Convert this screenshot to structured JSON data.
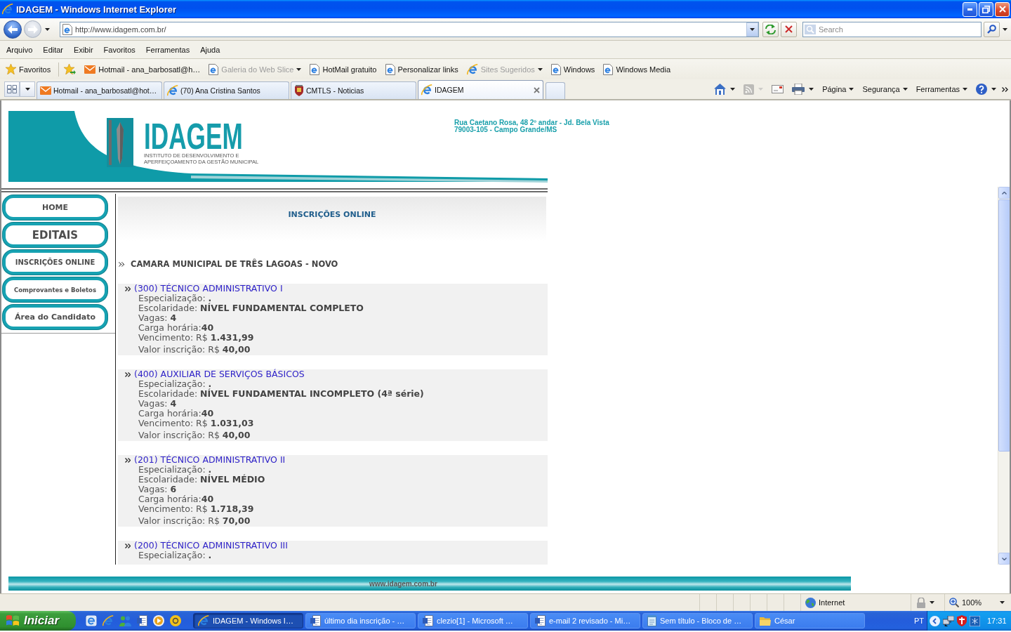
{
  "window": {
    "title": "IDAGEM - Windows Internet Explorer"
  },
  "address_bar": {
    "url": "http://www.idagem.com.br/"
  },
  "search": {
    "placeholder": "Search"
  },
  "menu": [
    "Arquivo",
    "Editar",
    "Exibir",
    "Favoritos",
    "Ferramentas",
    "Ajuda"
  ],
  "favorites_bar": {
    "label": "Favoritos",
    "links": [
      {
        "label": "Hotmail - ana_barbosatl@h…",
        "kind": "mail",
        "disabled": false,
        "dropdown": false
      },
      {
        "label": "Galeria do Web Slice",
        "kind": "page",
        "disabled": true,
        "dropdown": true
      },
      {
        "label": "HotMail gratuito",
        "kind": "page",
        "disabled": false,
        "dropdown": false
      },
      {
        "label": "Personalizar links",
        "kind": "page",
        "disabled": false,
        "dropdown": false
      },
      {
        "label": "Sites Sugeridos",
        "kind": "ie",
        "disabled": true,
        "dropdown": true
      },
      {
        "label": "Windows",
        "kind": "page",
        "disabled": false,
        "dropdown": false
      },
      {
        "label": "Windows Media",
        "kind": "page",
        "disabled": false,
        "dropdown": false
      }
    ]
  },
  "tabs": [
    {
      "label": "Hotmail - ana_barbosatl@hot…",
      "kind": "mail",
      "selected": false
    },
    {
      "label": "(70) Ana Cristina Santos",
      "kind": "ie",
      "selected": false
    },
    {
      "label": "CMTLS - Noticias",
      "kind": "crest",
      "selected": false
    },
    {
      "label": "IDAGEM",
      "kind": "ie",
      "selected": true
    }
  ],
  "command_bar": {
    "tools": [
      {
        "kind": "home",
        "dropdown": true,
        "disabled": false
      },
      {
        "kind": "feeds",
        "dropdown": true,
        "disabled": true
      },
      {
        "kind": "mail",
        "dropdown": false,
        "disabled": false
      },
      {
        "kind": "print",
        "dropdown": true,
        "disabled": false
      }
    ],
    "menus": [
      "Página",
      "Segurança",
      "Ferramentas"
    ]
  },
  "site": {
    "logo": {
      "wordmark": "IDAGEM",
      "tagline": [
        "INSTITUTO DE DESENVOLVIMENTO E",
        "APERFEIÇOAMENTO DA GESTÃO MUNICIPAL"
      ]
    },
    "address": [
      "Rua Caetano Rosa, 48 2º andar - Jd. Bela Vista",
      "79003-105 - Campo Grande/MS"
    ],
    "nav": [
      "HOME",
      "EDITAIS",
      "INSCRIÇÕES ONLINE",
      "Comprovantes e Boletos",
      "Área do Candidato"
    ],
    "heading": "INSCRIÇÕES ONLINE",
    "organization": "CAMARA MUNICIPAL DE TRÊS LAGOAS - NOVO",
    "positions": [
      {
        "title": "(300) TÉCNICO ADMINISTRATIVO I",
        "details": [
          "Especialização: **.**",
          "Escolaridade: **NÍVEL FUNDAMENTAL COMPLETO**",
          "Vagas: **4**",
          "Carga horária:**40**",
          "Vencimento: R$ **1.431,99**",
          "Valor inscrição: R$ **40,00**"
        ]
      },
      {
        "title": "(400) AUXILIAR DE SERVIÇOS BÁSICOS",
        "details": [
          "Especialização: **.**",
          "Escolaridade: **NÍVEL FUNDAMENTAL INCOMPLETO (4ª série)**",
          "Vagas: **4**",
          "Carga horária:**40**",
          "Vencimento: R$ **1.031,03**",
          "Valor inscrição: R$ **40,00**"
        ]
      },
      {
        "title": "(201) TÉCNICO ADMINISTRATIVO II",
        "details": [
          "Especialização: **.**",
          "Escolaridade: **NÍVEL MÉDIO**",
          "Vagas: **6**",
          "Carga horária:**40**",
          "Vencimento: R$ **1.718,39**",
          "Valor inscrição: R$ **70,00**"
        ]
      },
      {
        "title": "(200) TÉCNICO ADMINISTRATIVO III",
        "details": [
          "Especialização: **.**"
        ]
      }
    ],
    "footer": "www.idagem.com.br"
  },
  "status_bar": {
    "zone": "Internet",
    "zoom": "100%"
  },
  "taskbar": {
    "start": "Iniciar",
    "tasks": [
      {
        "label": "IDAGEM - Windows I…",
        "kind": "ie",
        "selected": true
      },
      {
        "label": "último dia inscrição - …",
        "kind": "word",
        "selected": false
      },
      {
        "label": "clezio[1] - Microsoft …",
        "kind": "word",
        "selected": false
      },
      {
        "label": "e-mail 2 revisado - Mi…",
        "kind": "word",
        "selected": false
      },
      {
        "label": "Sem título - Bloco de …",
        "kind": "notepad",
        "selected": false
      },
      {
        "label": "César",
        "kind": "folder",
        "selected": false
      }
    ],
    "language": "PT",
    "clock": "17:31"
  }
}
